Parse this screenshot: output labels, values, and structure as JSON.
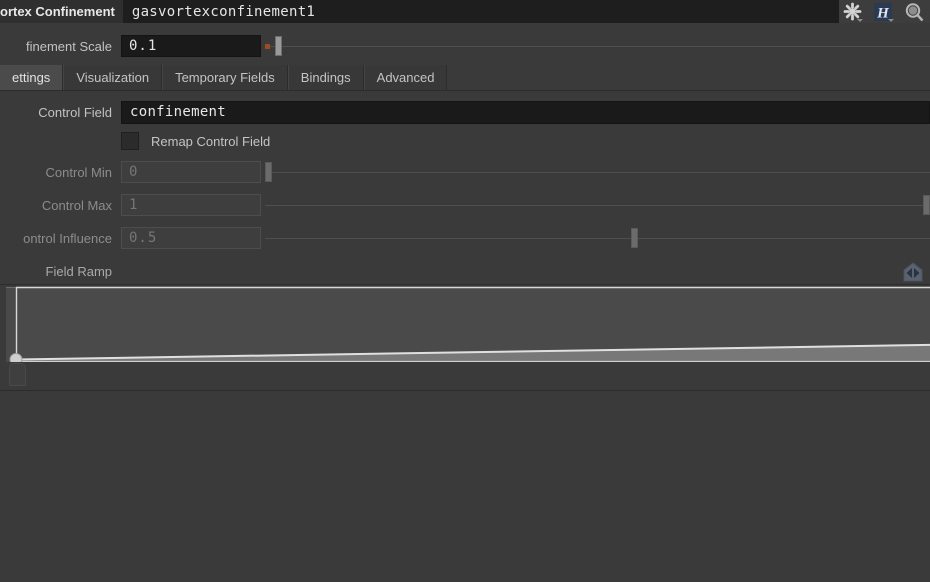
{
  "header": {
    "node_type_label": "ortex Confinement",
    "node_name": "gasvortexconfinement1",
    "icons": [
      {
        "name": "asterisk-icon",
        "glyph": "asterisk"
      },
      {
        "name": "houdini-h-icon",
        "glyph": "H"
      },
      {
        "name": "search-icon",
        "glyph": "magnifier"
      }
    ]
  },
  "confinement_scale": {
    "label": "finement Scale",
    "value": "0.1",
    "slider_percent": 2.0
  },
  "tabs": [
    {
      "label": "ettings",
      "active": true
    },
    {
      "label": "Visualization",
      "active": false
    },
    {
      "label": "Temporary Fields",
      "active": false
    },
    {
      "label": "Bindings",
      "active": false
    },
    {
      "label": "Advanced",
      "active": false
    }
  ],
  "control_field": {
    "label": "Control Field",
    "value": "confinement"
  },
  "remap_control_field": {
    "label": "Remap Control Field",
    "checked": false
  },
  "control_min": {
    "label": "Control Min",
    "value": "0",
    "disabled": true,
    "slider_percent": 0.0
  },
  "control_max": {
    "label": "Control Max",
    "value": "1",
    "disabled": true,
    "slider_percent": 100.0
  },
  "control_influence": {
    "label": "ontrol Influence",
    "value": "0.5",
    "disabled": true,
    "slider_percent": 55.5
  },
  "field_ramp": {
    "label": "Field Ramp",
    "flip_icon": "flip-ramp-icon",
    "keys": [
      {
        "position": 0.0,
        "value": 0.02
      },
      {
        "position": 1.0,
        "value": 0.22
      }
    ]
  },
  "colors": {
    "panel_bg": "#3a3a3a",
    "header_bg": "#1e1e1e",
    "field_bg": "#1a1a1a",
    "accent_orange": "#a04a22",
    "ramp_above": "#4a4a4a",
    "ramp_below": "#787878",
    "ramp_curve": "#e0e0e0"
  }
}
